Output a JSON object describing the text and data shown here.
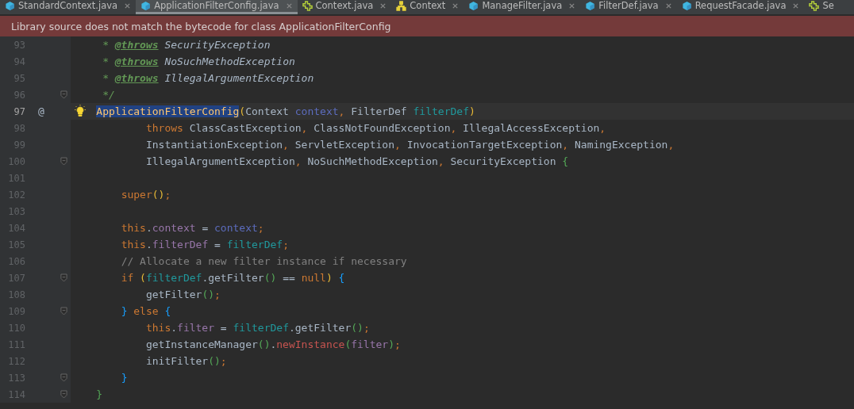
{
  "tabs": [
    {
      "label": "StandardContext.java",
      "kind": "class",
      "selected": false,
      "closable": true
    },
    {
      "label": "ApplicationFilterConfig.java",
      "kind": "class",
      "selected": true,
      "closable": true
    },
    {
      "label": "Context.java",
      "kind": "interface",
      "selected": false,
      "closable": true
    },
    {
      "label": "Context",
      "kind": "hierarchy",
      "selected": false,
      "closable": true
    },
    {
      "label": "ManageFilter.java",
      "kind": "class",
      "selected": false,
      "closable": true
    },
    {
      "label": "FilterDef.java",
      "kind": "class",
      "selected": false,
      "closable": true
    },
    {
      "label": "RequestFacade.java",
      "kind": "class",
      "selected": false,
      "closable": true
    },
    {
      "label": "Se",
      "kind": "interface",
      "selected": false,
      "closable": false
    }
  ],
  "banner": {
    "text": "Library source does not match the bytecode for class ApplicationFilterConfig"
  },
  "lines": [
    {
      "number": "93",
      "current": false,
      "fold": false,
      "tokens": [
        {
          "text": "     * ",
          "kind": "doc"
        },
        {
          "text": "@throws",
          "kind": "doctag"
        },
        {
          "text": " SecurityException",
          "kind": "docref"
        }
      ]
    },
    {
      "number": "94",
      "current": false,
      "fold": false,
      "tokens": [
        {
          "text": "     * ",
          "kind": "doc"
        },
        {
          "text": "@throws",
          "kind": "doctag"
        },
        {
          "text": " NoSuchMethodException",
          "kind": "docref"
        }
      ]
    },
    {
      "number": "95",
      "current": false,
      "fold": false,
      "tokens": [
        {
          "text": "     * ",
          "kind": "doc"
        },
        {
          "text": "@throws",
          "kind": "doctag"
        },
        {
          "text": " IllegalArgumentException",
          "kind": "docref"
        }
      ]
    },
    {
      "number": "96",
      "current": false,
      "fold": true,
      "tokens": [
        {
          "text": "     */",
          "kind": "doc"
        }
      ]
    },
    {
      "number": "97",
      "current": true,
      "fold": false,
      "gutter_mark": "@",
      "bulb": true,
      "tokens": [
        {
          "text": "    ApplicationFilterConfig",
          "kind": "decl",
          "selected": true
        },
        {
          "text": "(",
          "kind": "paren1"
        },
        {
          "text": "Context ",
          "kind": "plain"
        },
        {
          "text": "context",
          "kind": "param"
        },
        {
          "text": ", ",
          "kind": "punct"
        },
        {
          "text": "FilterDef ",
          "kind": "plain"
        },
        {
          "text": "filterDef",
          "kind": "local"
        },
        {
          "text": ")",
          "kind": "paren1"
        }
      ]
    },
    {
      "number": "98",
      "current": false,
      "fold": false,
      "tokens": [
        {
          "text": "            throws",
          "kind": "kw"
        },
        {
          "text": " ClassCastException",
          "kind": "plain"
        },
        {
          "text": ",",
          "kind": "punct"
        },
        {
          "text": " ClassNotFoundException",
          "kind": "plain"
        },
        {
          "text": ",",
          "kind": "punct"
        },
        {
          "text": " IllegalAccessException",
          "kind": "plain"
        },
        {
          "text": ",",
          "kind": "punct"
        }
      ]
    },
    {
      "number": "99",
      "current": false,
      "fold": false,
      "tokens": [
        {
          "text": "            InstantiationException",
          "kind": "plain"
        },
        {
          "text": ",",
          "kind": "punct"
        },
        {
          "text": " ServletException",
          "kind": "plain"
        },
        {
          "text": ",",
          "kind": "punct"
        },
        {
          "text": " InvocationTargetException",
          "kind": "plain"
        },
        {
          "text": ",",
          "kind": "punct"
        },
        {
          "text": " NamingException",
          "kind": "plain"
        },
        {
          "text": ",",
          "kind": "punct"
        }
      ]
    },
    {
      "number": "100",
      "current": false,
      "fold": true,
      "tokens": [
        {
          "text": "            IllegalArgumentException",
          "kind": "plain"
        },
        {
          "text": ",",
          "kind": "punct"
        },
        {
          "text": " NoSuchMethodException",
          "kind": "plain"
        },
        {
          "text": ",",
          "kind": "punct"
        },
        {
          "text": " SecurityException ",
          "kind": "plain"
        },
        {
          "text": "{",
          "kind": "paren2"
        }
      ]
    },
    {
      "number": "101",
      "current": false,
      "fold": false
    },
    {
      "number": "102",
      "current": false,
      "fold": false,
      "tokens": [
        {
          "text": "        super",
          "kind": "kw"
        },
        {
          "text": "()",
          "kind": "paren1"
        },
        {
          "text": ";",
          "kind": "punct"
        }
      ]
    },
    {
      "number": "103",
      "current": false,
      "fold": false
    },
    {
      "number": "104",
      "current": false,
      "fold": false,
      "tokens": [
        {
          "text": "        this",
          "kind": "kw"
        },
        {
          "text": ".",
          "kind": "plain"
        },
        {
          "text": "context",
          "kind": "field"
        },
        {
          "text": " = ",
          "kind": "plain"
        },
        {
          "text": "context",
          "kind": "param"
        },
        {
          "text": ";",
          "kind": "punct"
        }
      ]
    },
    {
      "number": "105",
      "current": false,
      "fold": false,
      "tokens": [
        {
          "text": "        this",
          "kind": "kw"
        },
        {
          "text": ".",
          "kind": "plain"
        },
        {
          "text": "filterDef",
          "kind": "field"
        },
        {
          "text": " = ",
          "kind": "plain"
        },
        {
          "text": "filterDef",
          "kind": "local"
        },
        {
          "text": ";",
          "kind": "punct"
        }
      ]
    },
    {
      "number": "106",
      "current": false,
      "fold": false,
      "tokens": [
        {
          "text": "        // Allocate a new filter instance if necessary",
          "kind": "comment"
        }
      ]
    },
    {
      "number": "107",
      "current": false,
      "fold": true,
      "tokens": [
        {
          "text": "        if",
          "kind": "kw"
        },
        {
          "text": " (",
          "kind": "paren1"
        },
        {
          "text": "filterDef",
          "kind": "local"
        },
        {
          "text": ".getFilter",
          "kind": "plain"
        },
        {
          "text": "()",
          "kind": "paren2"
        },
        {
          "text": " == ",
          "kind": "plain"
        },
        {
          "text": "null",
          "kind": "kw"
        },
        {
          "text": ")",
          "kind": "paren1"
        },
        {
          "text": " {",
          "kind": "brace"
        }
      ]
    },
    {
      "number": "108",
      "current": false,
      "fold": false,
      "tokens": [
        {
          "text": "            getFilter",
          "kind": "plain"
        },
        {
          "text": "()",
          "kind": "paren2"
        },
        {
          "text": ";",
          "kind": "punct"
        }
      ]
    },
    {
      "number": "109",
      "current": false,
      "fold": true,
      "tokens": [
        {
          "text": "        }",
          "kind": "brace"
        },
        {
          "text": " else",
          "kind": "kw"
        },
        {
          "text": " {",
          "kind": "brace"
        }
      ]
    },
    {
      "number": "110",
      "current": false,
      "fold": false,
      "tokens": [
        {
          "text": "            this",
          "kind": "kw"
        },
        {
          "text": ".",
          "kind": "plain"
        },
        {
          "text": "filter",
          "kind": "field"
        },
        {
          "text": " = ",
          "kind": "plain"
        },
        {
          "text": "filterDef",
          "kind": "local"
        },
        {
          "text": ".getFilter",
          "kind": "plain"
        },
        {
          "text": "()",
          "kind": "paren2"
        },
        {
          "text": ";",
          "kind": "punct"
        }
      ]
    },
    {
      "number": "111",
      "current": false,
      "fold": false,
      "tokens": [
        {
          "text": "            getInstanceManager",
          "kind": "plain"
        },
        {
          "text": "()",
          "kind": "paren2"
        },
        {
          "text": ".",
          "kind": "plain"
        },
        {
          "text": "newInstance",
          "kind": "call"
        },
        {
          "text": "(",
          "kind": "paren2"
        },
        {
          "text": "filter",
          "kind": "field"
        },
        {
          "text": ")",
          "kind": "paren2"
        },
        {
          "text": ";",
          "kind": "punct"
        }
      ]
    },
    {
      "number": "112",
      "current": false,
      "fold": false,
      "tokens": [
        {
          "text": "            initFilter",
          "kind": "plain"
        },
        {
          "text": "()",
          "kind": "paren2"
        },
        {
          "text": ";",
          "kind": "punct"
        }
      ]
    },
    {
      "number": "113",
      "current": false,
      "fold": true,
      "tokens": [
        {
          "text": "        }",
          "kind": "brace"
        }
      ]
    },
    {
      "number": "114",
      "current": false,
      "fold": true,
      "tokens": [
        {
          "text": "    }",
          "kind": "paren2"
        }
      ]
    }
  ]
}
